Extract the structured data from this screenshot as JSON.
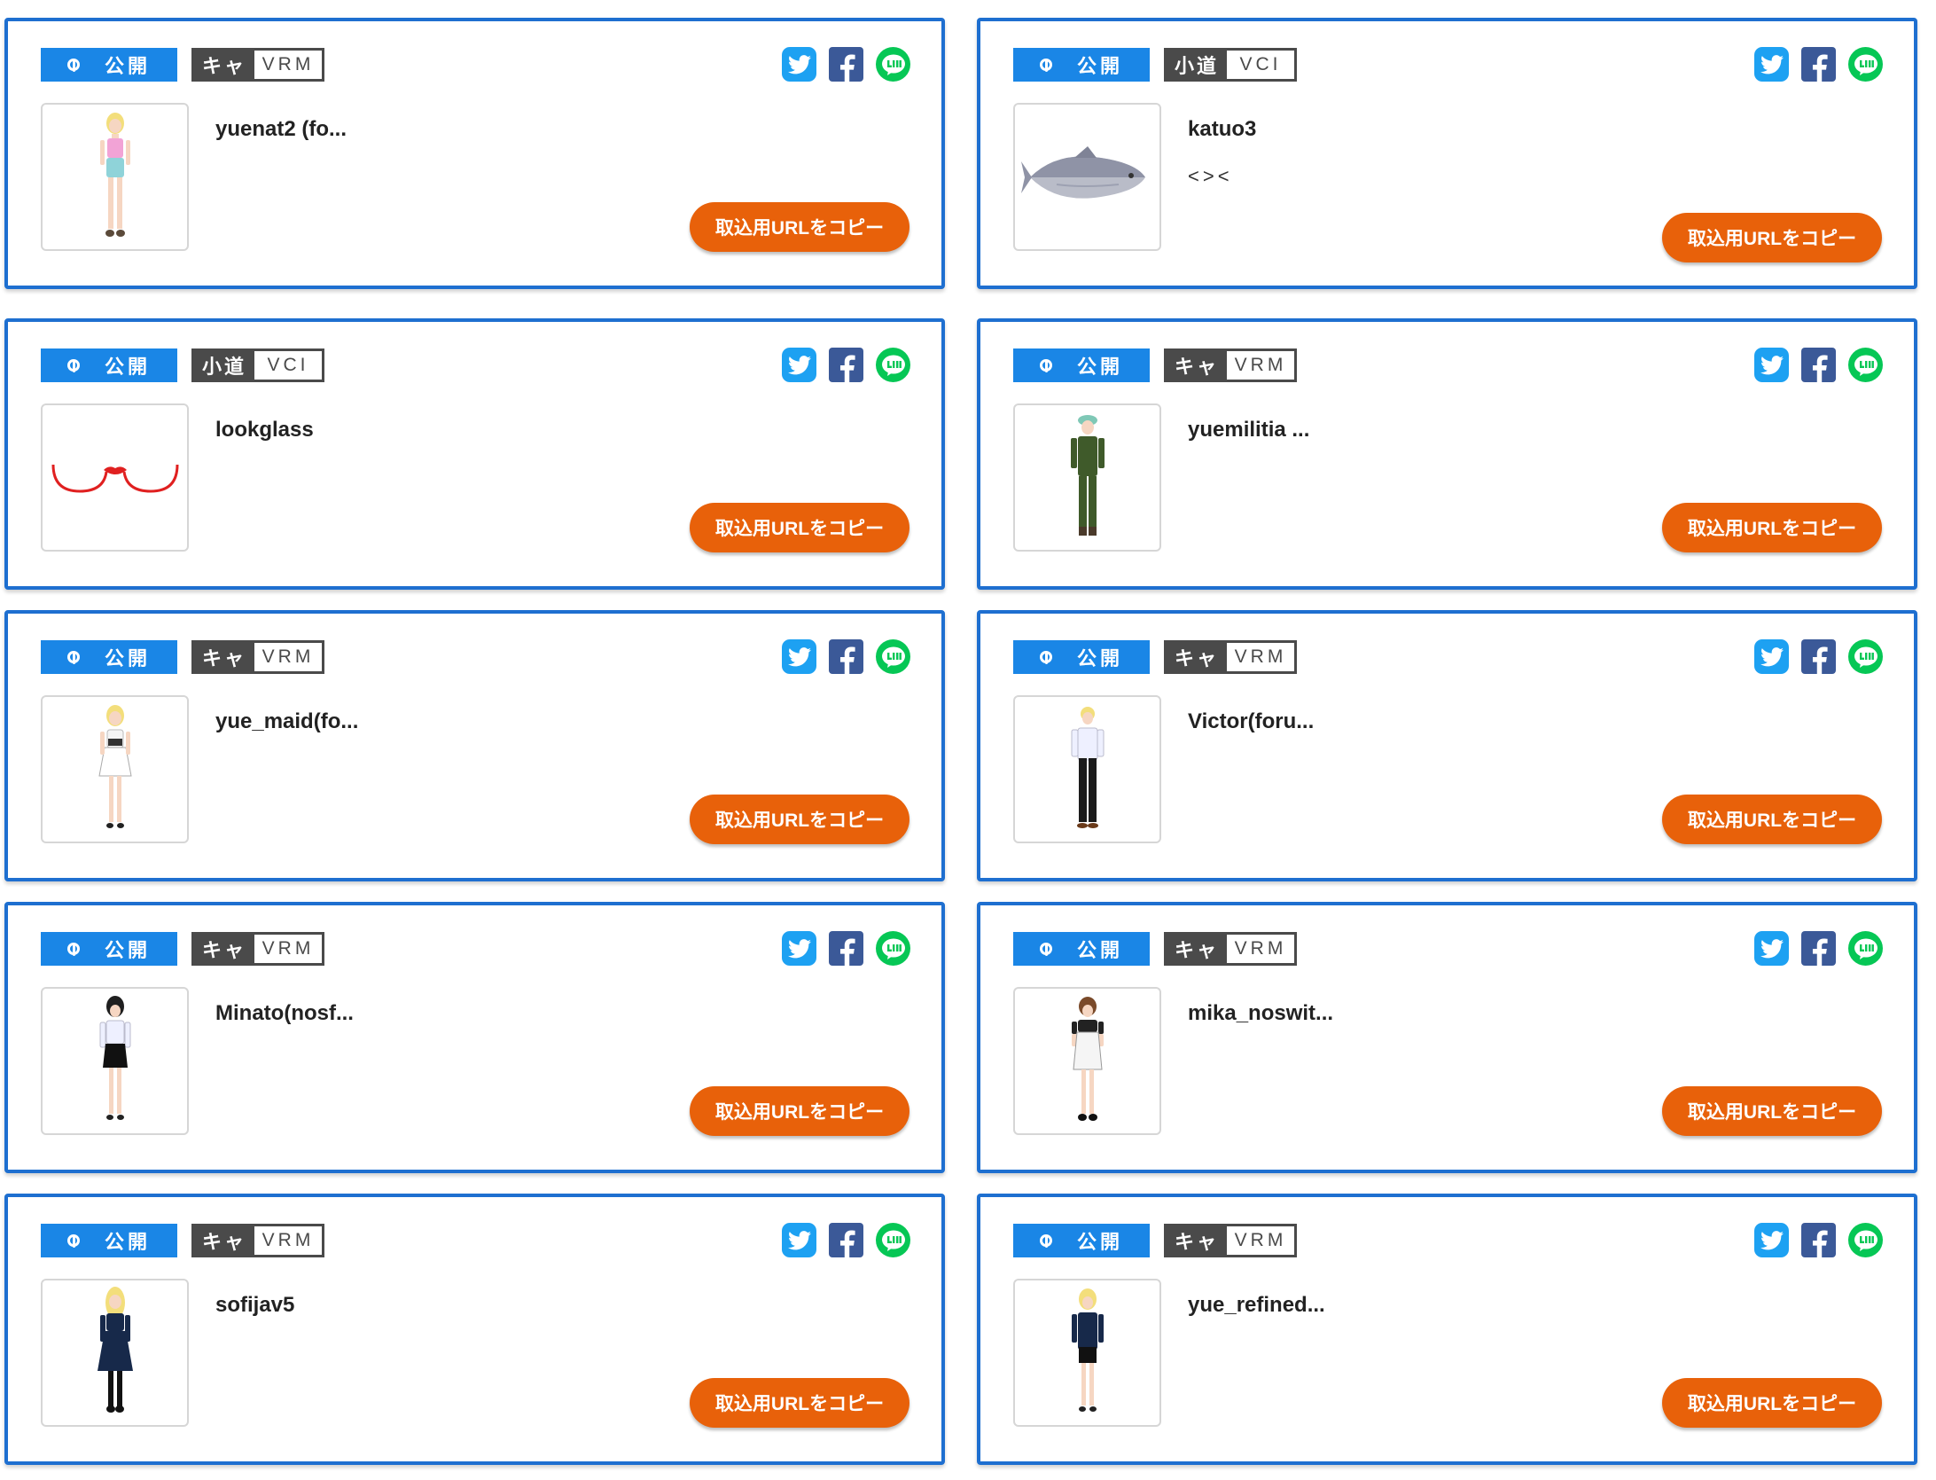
{
  "labels": {
    "public": "公開",
    "copy_button": "取込用URLをコピー"
  },
  "icons": {
    "public": "globe-icon",
    "share": [
      "twitter-icon",
      "facebook-icon",
      "line-icon"
    ]
  },
  "colors": {
    "card_border": "#1e6fd0",
    "public_badge": "#1a86e6",
    "type_badge": "#4a4a4a",
    "copy_button": "#e8610a",
    "twitter": "#1da1f2",
    "facebook": "#3b5998",
    "line": "#06c755"
  },
  "items": [
    {
      "category": "キャ",
      "format": "VRM",
      "name": "yuenat2 (fo...",
      "description": "",
      "thumb": "avatar-pink-top"
    },
    {
      "category": "小道",
      "format": "VCI",
      "name": "katuo3",
      "description": "<><",
      "thumb": "fish"
    },
    {
      "category": "小道",
      "format": "VCI",
      "name": "lookglass",
      "description": "",
      "thumb": "glasses"
    },
    {
      "category": "キャ",
      "format": "VRM",
      "name": "yuemilitia ...",
      "description": "",
      "thumb": "avatar-green-uniform"
    },
    {
      "category": "キャ",
      "format": "VRM",
      "name": "yue_maid(fo...",
      "description": "",
      "thumb": "avatar-white-dress"
    },
    {
      "category": "キャ",
      "format": "VRM",
      "name": "Victor(foru...",
      "description": "",
      "thumb": "avatar-shirt-black-pants"
    },
    {
      "category": "キャ",
      "format": "VRM",
      "name": "Minato(nosf...",
      "description": "",
      "thumb": "avatar-black-hair-skirt"
    },
    {
      "category": "キャ",
      "format": "VRM",
      "name": "mika_noswit...",
      "description": "",
      "thumb": "avatar-brown-hair-apron"
    },
    {
      "category": "キャ",
      "format": "VRM",
      "name": "sofijav5",
      "description": "",
      "thumb": "avatar-navy-dress"
    },
    {
      "category": "キャ",
      "format": "VRM",
      "name": "yue_refined...",
      "description": "",
      "thumb": "avatar-navy-jacket"
    }
  ]
}
